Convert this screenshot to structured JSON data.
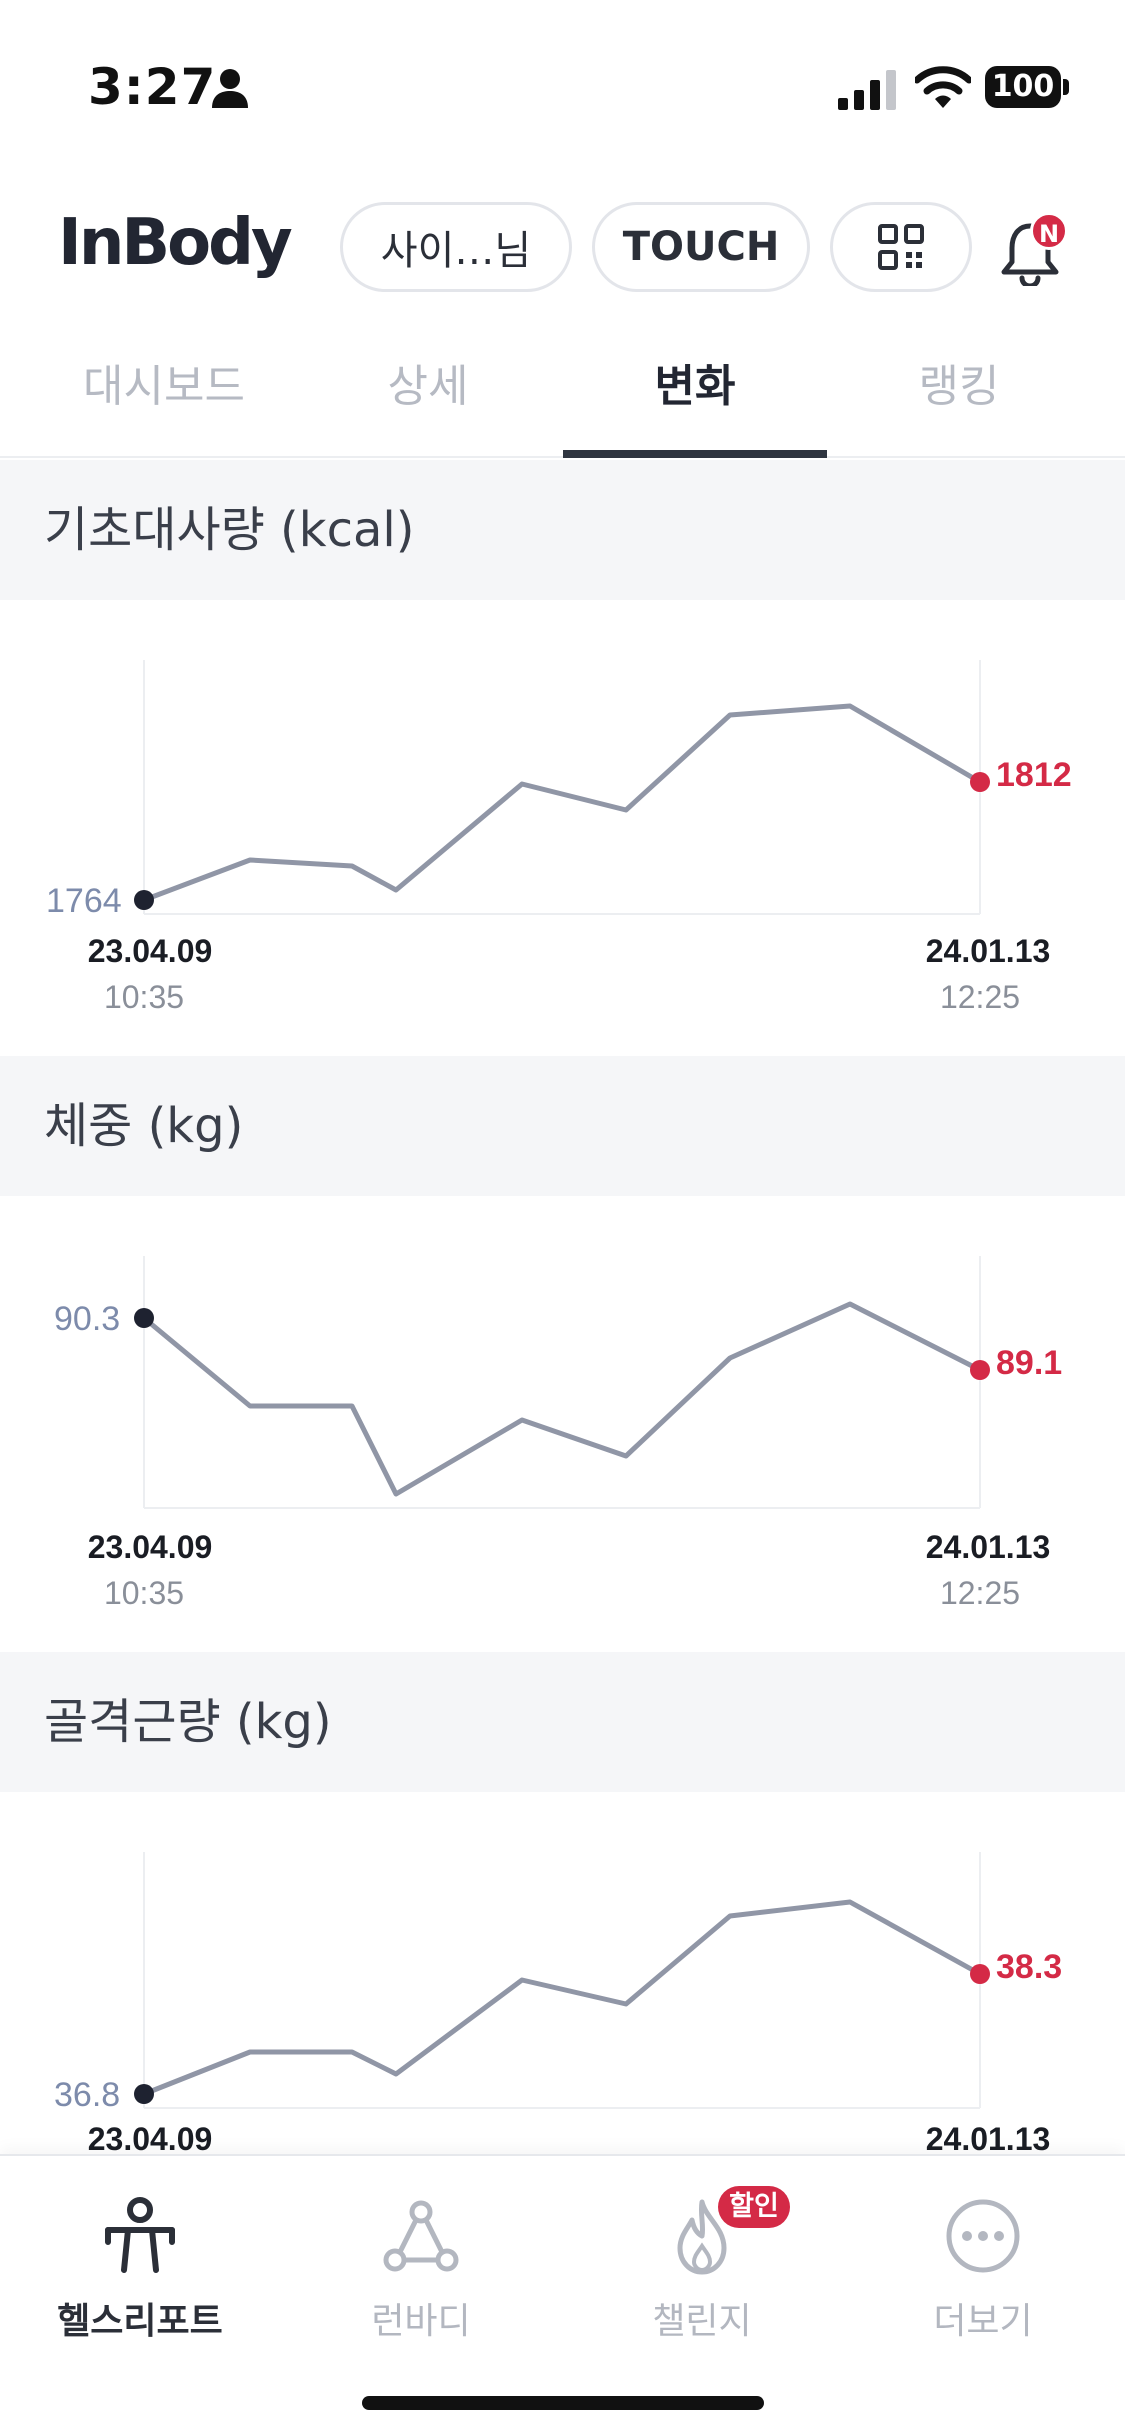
{
  "status_bar": {
    "time": "3:27",
    "battery": "100"
  },
  "header": {
    "logo": "InBody",
    "user_pill": "사이…님",
    "touch_pill": "TOUCH",
    "notification_badge": "N"
  },
  "tabs": [
    {
      "label": "대시보드",
      "active": false
    },
    {
      "label": "상세",
      "active": false
    },
    {
      "label": "변화",
      "active": true
    },
    {
      "label": "랭킹",
      "active": false
    }
  ],
  "colors": {
    "line": "#9096a6",
    "highlight": "#d42a46",
    "start_dot": "#1e2230",
    "axis": "#eceef1"
  },
  "charts": [
    {
      "title": "기초대사량 (kcal)",
      "start_value": "1764",
      "end_value": "1812",
      "start_date": "23.04.09",
      "start_time": "10:35",
      "end_date": "24.01.13",
      "end_time": "12:25"
    },
    {
      "title": "체중 (kg)",
      "start_value": "90.3",
      "end_value": "89.1",
      "start_date": "23.04.09",
      "start_time": "10:35",
      "end_date": "24.01.13",
      "end_time": "12:25"
    },
    {
      "title": "골격근량 (kg)",
      "start_value": "36.8",
      "end_value": "38.3",
      "start_date": "23.04.09",
      "start_time": "",
      "end_date": "24.01.13",
      "end_time": ""
    }
  ],
  "bottom_nav": [
    {
      "label": "헬스리포트",
      "icon": "health-report-icon",
      "active": true
    },
    {
      "label": "런바디",
      "icon": "runbody-icon",
      "active": false
    },
    {
      "label": "챌린지",
      "icon": "flame-icon",
      "active": false
    },
    {
      "label": "더보기",
      "icon": "more-dots-icon",
      "active": false
    }
  ],
  "challenge_badge": "할인"
}
